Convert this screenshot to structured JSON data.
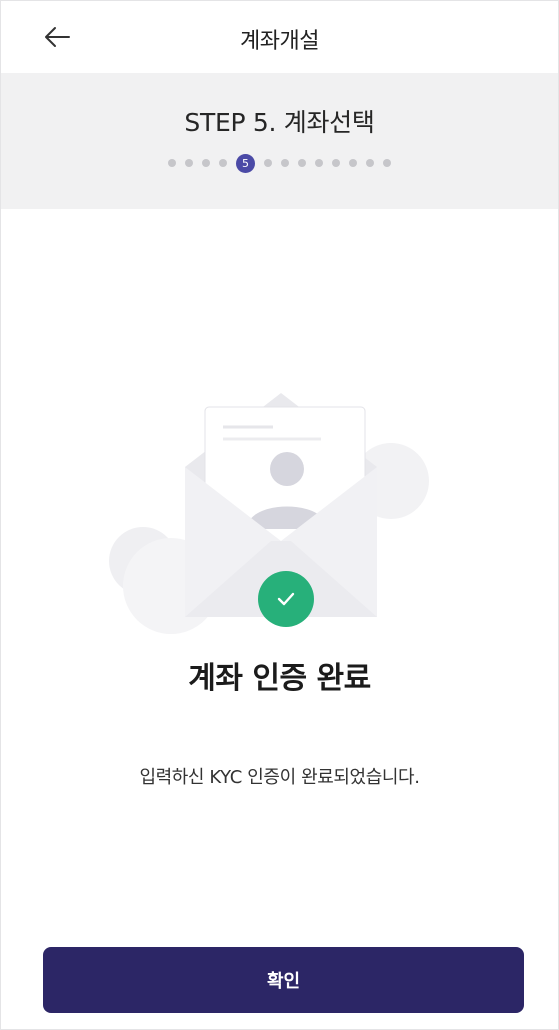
{
  "header": {
    "title": "계좌개설",
    "back_icon": "arrow-left-icon"
  },
  "step": {
    "title": "STEP 5. 계좌선택",
    "total_steps": 13,
    "current_step": 5,
    "current_label": "5"
  },
  "result": {
    "illustration_icon": "envelope-with-profile-card-icon",
    "status_icon": "check-circle-icon",
    "title": "계좌 인증 완료",
    "description": "입력하신 KYC 인증이 완료되었습니다."
  },
  "footer": {
    "confirm_label": "확인"
  },
  "colors": {
    "primary": "#2c2666",
    "step_active": "#4b4aa6",
    "success": "#27b07a",
    "band_bg": "#f1f1f2"
  }
}
